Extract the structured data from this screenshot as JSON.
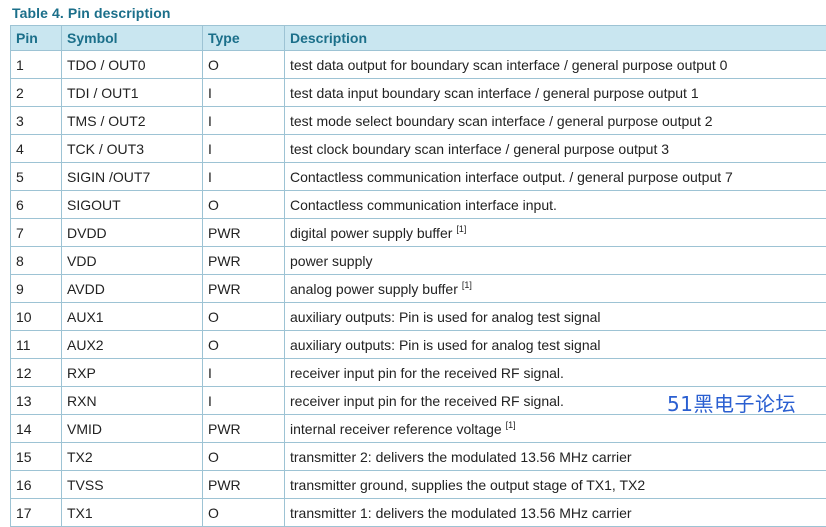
{
  "table": {
    "caption": "Table 4.  Pin description",
    "headers": [
      "Pin",
      "Symbol",
      "Type",
      "Description"
    ],
    "rows": [
      {
        "pin": "1",
        "symbol": "TDO / OUT0",
        "type": "O",
        "description": "test data output for boundary scan interface / general purpose output 0",
        "note": ""
      },
      {
        "pin": "2",
        "symbol": "TDI / OUT1",
        "type": "I",
        "description": "test data input boundary scan interface / general purpose output 1",
        "note": ""
      },
      {
        "pin": "3",
        "symbol": "TMS / OUT2",
        "type": "I",
        "description": "test mode select boundary scan interface / general purpose output 2",
        "note": ""
      },
      {
        "pin": "4",
        "symbol": "TCK / OUT3",
        "type": "I",
        "description": "test clock boundary scan interface / general purpose output 3",
        "note": ""
      },
      {
        "pin": "5",
        "symbol": "SIGIN /OUT7",
        "type": "I",
        "description": "Contactless communication interface output. / general purpose output 7",
        "note": ""
      },
      {
        "pin": "6",
        "symbol": "SIGOUT",
        "type": "O",
        "description": "Contactless communication interface input.",
        "note": ""
      },
      {
        "pin": "7",
        "symbol": "DVDD",
        "type": "PWR",
        "description": "digital power supply buffer",
        "note": "[1]"
      },
      {
        "pin": "8",
        "symbol": "VDD",
        "type": "PWR",
        "description": "power supply",
        "note": ""
      },
      {
        "pin": "9",
        "symbol": "AVDD",
        "type": "PWR",
        "description": "analog power supply buffer",
        "note": "[1]"
      },
      {
        "pin": "10",
        "symbol": "AUX1",
        "type": "O",
        "description": "auxiliary outputs: Pin is used for analog test signal",
        "note": ""
      },
      {
        "pin": "11",
        "symbol": "AUX2",
        "type": "O",
        "description": "auxiliary outputs: Pin is used for analog test signal",
        "note": ""
      },
      {
        "pin": "12",
        "symbol": "RXP",
        "type": "I",
        "description": "receiver input pin for the received RF signal.",
        "note": ""
      },
      {
        "pin": "13",
        "symbol": "RXN",
        "type": "I",
        "description": "receiver input pin for the received RF signal.",
        "note": ""
      },
      {
        "pin": "14",
        "symbol": "VMID",
        "type": "PWR",
        "description": "internal receiver reference voltage",
        "note": "[1]"
      },
      {
        "pin": "15",
        "symbol": "TX2",
        "type": "O",
        "description": "transmitter 2: delivers the modulated 13.56 MHz carrier",
        "note": ""
      },
      {
        "pin": "16",
        "symbol": "TVSS",
        "type": "PWR",
        "description": "transmitter ground, supplies the output stage of TX1, TX2",
        "note": ""
      },
      {
        "pin": "17",
        "symbol": "TX1",
        "type": "O",
        "description": "transmitter 1: delivers the modulated 13.56 MHz carrier",
        "note": ""
      }
    ]
  },
  "watermark": "51黑电子论坛",
  "colors": {
    "caption": "#1b6f8a",
    "header_bg": "#c9e6f0",
    "border": "#9dc3d4",
    "watermark": "#2a5fd1"
  }
}
